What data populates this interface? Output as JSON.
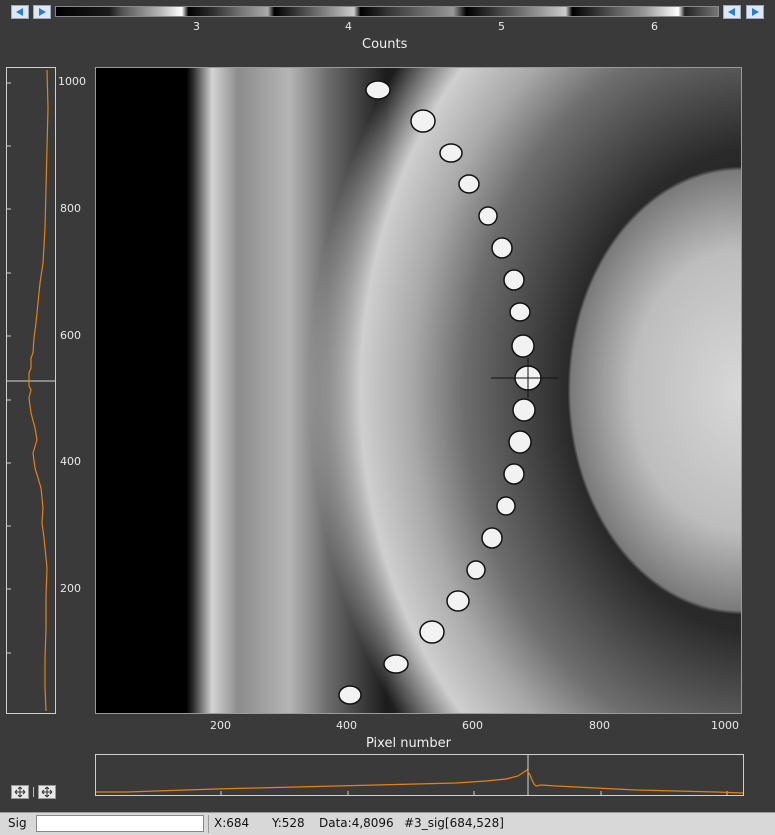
{
  "colorbar": {
    "tick_labels": [
      "3",
      "4",
      "5",
      "6"
    ],
    "axis_title": "Counts"
  },
  "image_view": {
    "x_axis_title": "Pixel number",
    "x_tick_labels": [
      "200",
      "400",
      "600",
      "800",
      "1000"
    ],
    "y_tick_labels": [
      "200",
      "400",
      "600",
      "800",
      "1000"
    ]
  },
  "status_bar": {
    "mode_label": "Sig",
    "input_value": "",
    "x_readout": "X:684",
    "y_readout": "Y:528",
    "data_readout": "Data:4,8096",
    "source_readout": "#3_sig[684,528]"
  },
  "icons": {
    "left_arrow": "left-arrow-icon",
    "right_arrow": "right-arrow-icon",
    "move": "move-icon"
  },
  "colors": {
    "background": "#3a3a3a",
    "profile_line": "#e8820c",
    "button_bg": "#dfe8f2",
    "arrow": "#2a7bd6"
  }
}
